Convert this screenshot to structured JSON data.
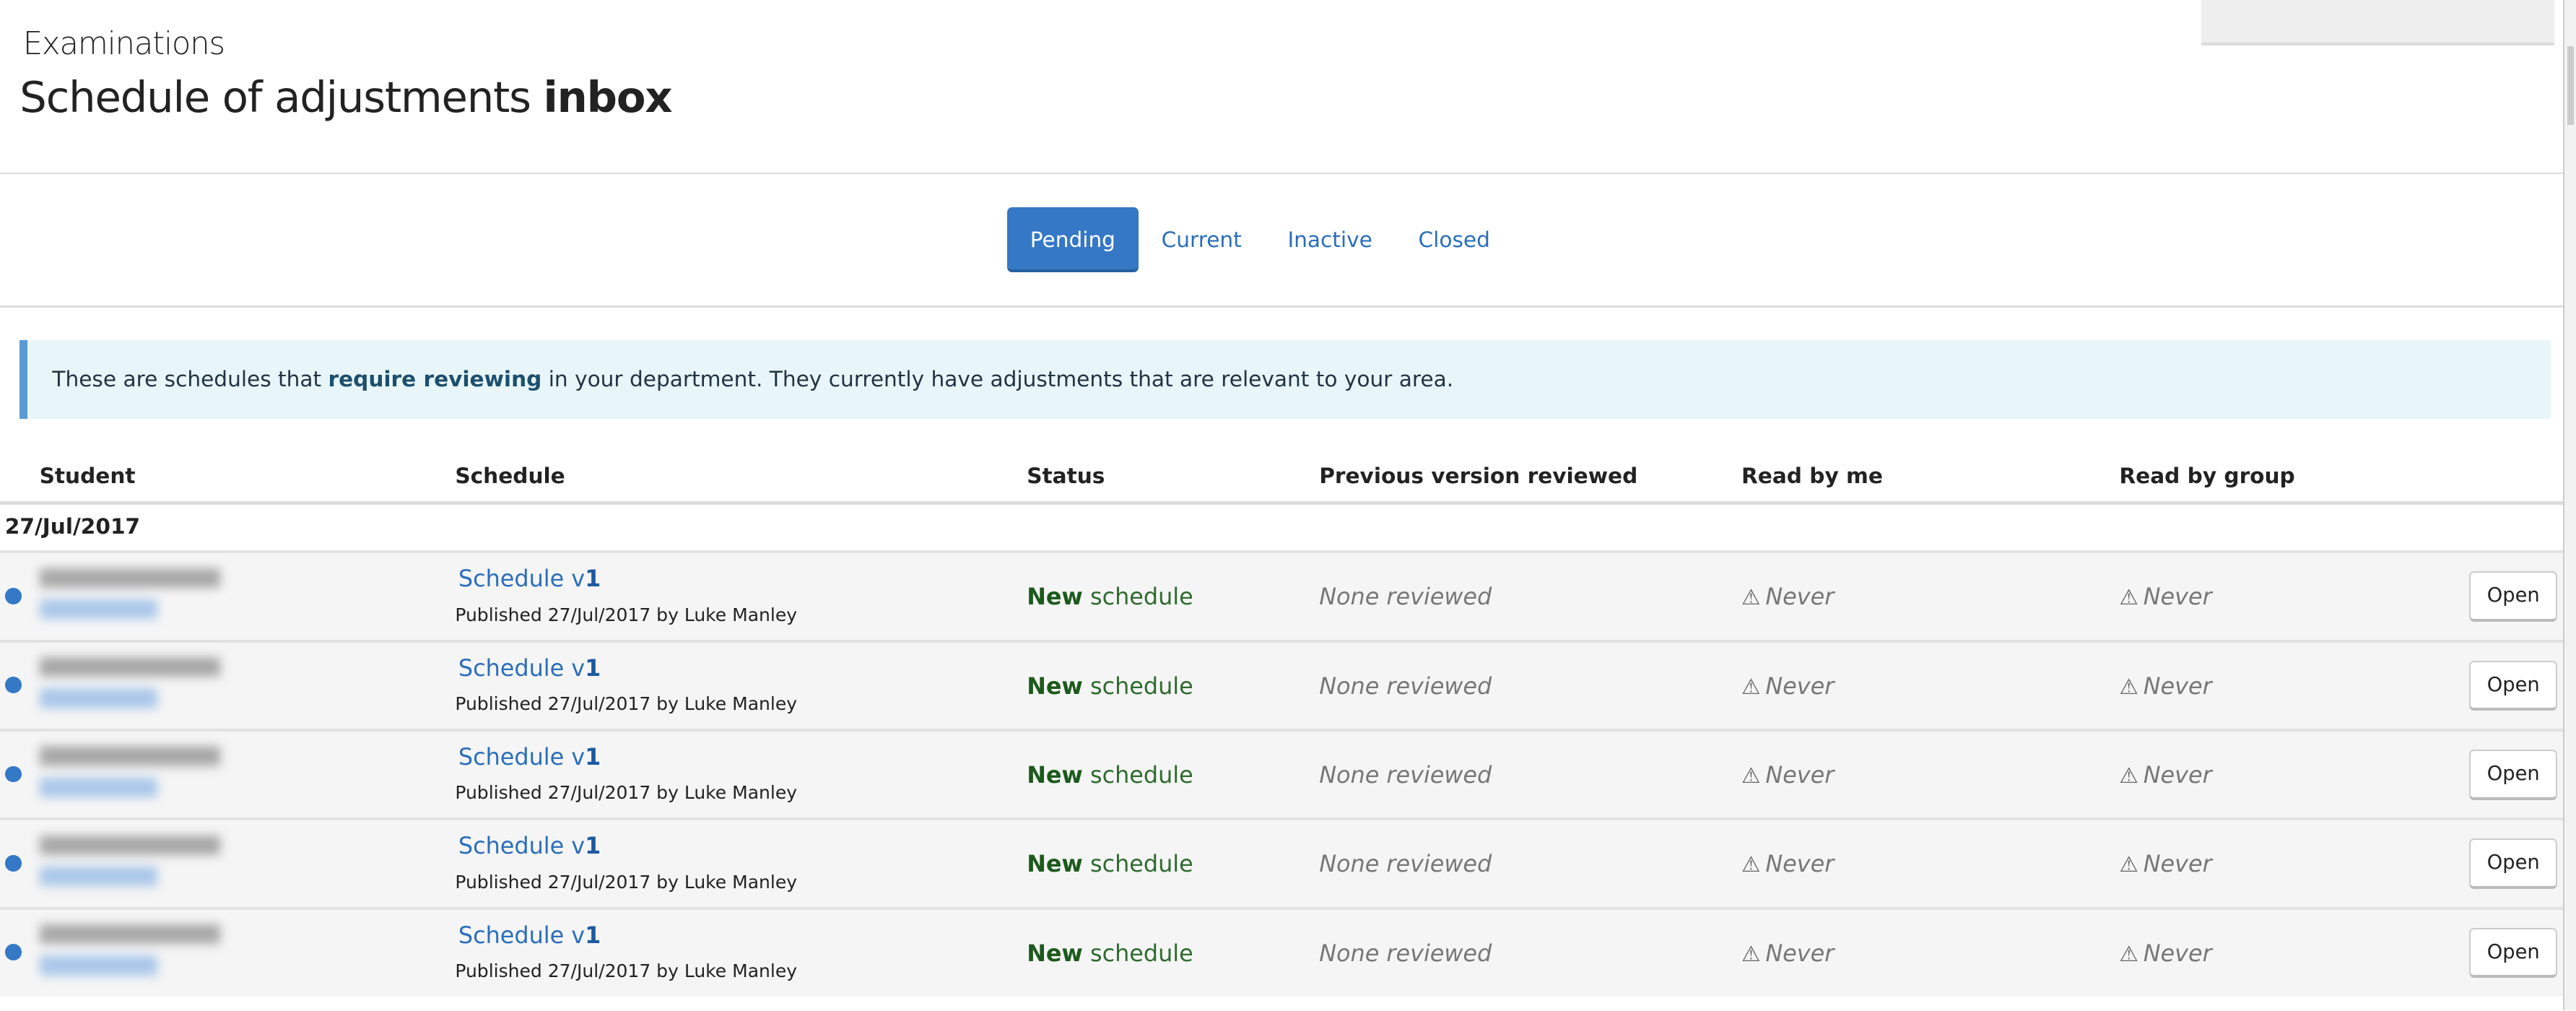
{
  "header": {
    "section": "Examinations",
    "title_prefix": "Schedule of adjustments",
    "title_bold": "inbox"
  },
  "tabs": [
    {
      "label": "Pending",
      "active": true
    },
    {
      "label": "Current",
      "active": false
    },
    {
      "label": "Inactive",
      "active": false
    },
    {
      "label": "Closed",
      "active": false
    }
  ],
  "alert": {
    "before": "These are schedules that ",
    "bold": "require reviewing",
    "after": " in your department. They currently have adjustments that are relevant to your area."
  },
  "table": {
    "columns": [
      "Student",
      "Schedule",
      "Status",
      "Previous version reviewed",
      "Read by me",
      "Read by group"
    ],
    "group_date": "27/Jul/2017",
    "rows": [
      {
        "schedule_prefix": "Schedule v",
        "version": "1",
        "published": "Published 27/Jul/2017 by Luke Manley",
        "status_bold": "New",
        "status_rest": " schedule",
        "previous": "None reviewed",
        "read_by_me": "Never",
        "read_by_group": "Never",
        "action": "Open"
      },
      {
        "schedule_prefix": "Schedule v",
        "version": "1",
        "published": "Published 27/Jul/2017 by Luke Manley",
        "status_bold": "New",
        "status_rest": " schedule",
        "previous": "None reviewed",
        "read_by_me": "Never",
        "read_by_group": "Never",
        "action": "Open"
      },
      {
        "schedule_prefix": "Schedule v",
        "version": "1",
        "published": "Published 27/Jul/2017 by Luke Manley",
        "status_bold": "New",
        "status_rest": " schedule",
        "previous": "None reviewed",
        "read_by_me": "Never",
        "read_by_group": "Never",
        "action": "Open"
      },
      {
        "schedule_prefix": "Schedule v",
        "version": "1",
        "published": "Published 27/Jul/2017 by Luke Manley",
        "status_bold": "New",
        "status_rest": " schedule",
        "previous": "None reviewed",
        "read_by_me": "Never",
        "read_by_group": "Never",
        "action": "Open"
      },
      {
        "schedule_prefix": "Schedule v",
        "version": "1",
        "published": "Published 27/Jul/2017 by Luke Manley",
        "status_bold": "New",
        "status_rest": " schedule",
        "previous": "None reviewed",
        "read_by_me": "Never",
        "read_by_group": "Never",
        "action": "Open"
      }
    ]
  },
  "icons": {
    "unread": "dot-icon",
    "warning": "warning-triangle-icon"
  },
  "colors": {
    "accent": "#3478c6",
    "link": "#2a6ebb",
    "status_new": "#2e6b2e",
    "alert_bg": "#e8f6f9"
  }
}
